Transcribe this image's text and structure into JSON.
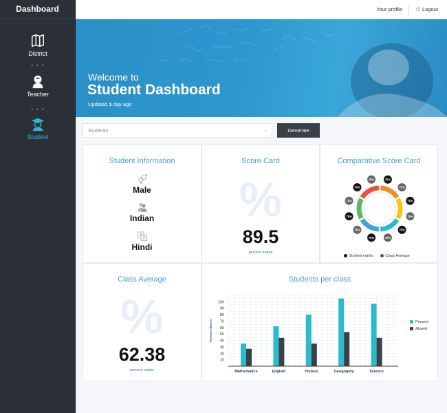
{
  "sidebar": {
    "title": "Dashboard",
    "items": [
      {
        "label": "District",
        "icon": "map-icon"
      },
      {
        "label": "Teacher",
        "icon": "teacher-icon"
      },
      {
        "label": "Student",
        "icon": "student-icon",
        "active": true
      }
    ],
    "separator": "• • •"
  },
  "topbar": {
    "profile_label": "Your profile",
    "logout_label": "Logout"
  },
  "hero": {
    "welcome": "Welcome to",
    "title": "Student Dashboard",
    "updated_prefix": "Updated",
    "updated_value": "1",
    "updated_suffix": "day ago"
  },
  "controls": {
    "select_value": "Students",
    "generate_label": "Generate"
  },
  "student_info": {
    "title": "Student Information",
    "gender": "Male",
    "nationality": "Indian",
    "language": "Hindi"
  },
  "score_card": {
    "title": "Score Card",
    "symbol": "%",
    "value": "89.5",
    "caption": "percent marks"
  },
  "comparative": {
    "title": "Comparative Score Card",
    "badge_value": "75%",
    "legend": [
      {
        "label": "Student marks",
        "color": "#111111"
      },
      {
        "label": "Class Average",
        "color": "#555555"
      }
    ]
  },
  "class_average": {
    "title": "Class Average",
    "symbol": "%",
    "value": "62.38",
    "caption": "percent marks"
  },
  "chart_data": {
    "type": "bar",
    "title": "Students per class",
    "ylabel": "Present Absent",
    "categories": [
      "Mathematics",
      "English",
      "History",
      "Geography",
      "Science"
    ],
    "series": [
      {
        "name": "Present",
        "color": "#2bbbc9",
        "values": [
          35,
          62,
          80,
          105,
          97
        ]
      },
      {
        "name": "Absent",
        "color": "#3a4047",
        "values": [
          27,
          44,
          35,
          53,
          44
        ]
      }
    ],
    "yticks": [
      10,
      20,
      30,
      40,
      50,
      60,
      70,
      80,
      90,
      100
    ],
    "ylim": [
      0,
      110
    ],
    "grid": true,
    "legend_position": "right"
  }
}
